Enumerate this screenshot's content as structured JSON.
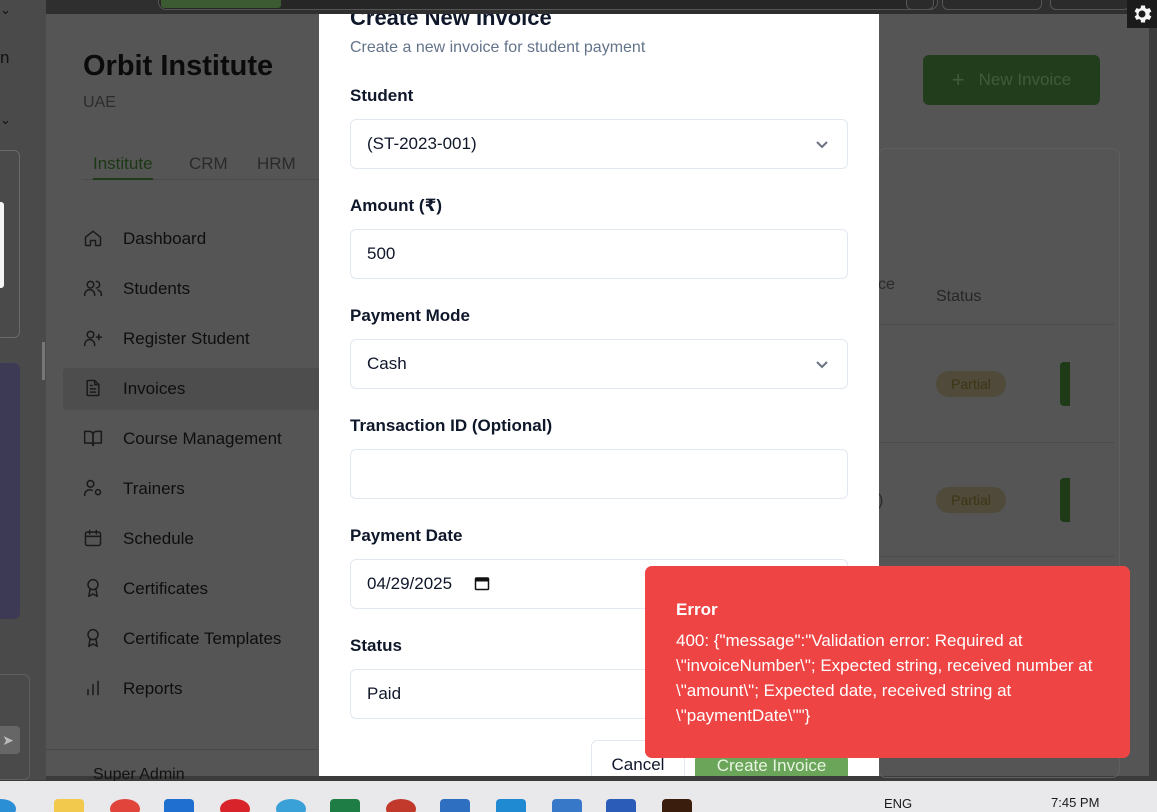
{
  "app": {
    "brand_title": "Orbit Institute",
    "brand_subtitle": "UAE",
    "tabs": [
      {
        "label": "Institute",
        "active": true
      },
      {
        "label": "CRM",
        "active": false
      },
      {
        "label": "HRM",
        "active": false
      }
    ],
    "nav": [
      {
        "label": "Dashboard",
        "icon": "home-icon"
      },
      {
        "label": "Students",
        "icon": "users-icon"
      },
      {
        "label": "Register Student",
        "icon": "user-plus-icon"
      },
      {
        "label": "Invoices",
        "icon": "file-text-icon",
        "active": true
      },
      {
        "label": "Course Management",
        "icon": "book-open-icon"
      },
      {
        "label": "Trainers",
        "icon": "user-cog-icon"
      },
      {
        "label": "Schedule",
        "icon": "calendar-icon"
      },
      {
        "label": "Certificates",
        "icon": "award-icon"
      },
      {
        "label": "Certificate Templates",
        "icon": "award-icon"
      },
      {
        "label": "Reports",
        "icon": "bar-chart-icon"
      }
    ],
    "footer_user": "Super Admin",
    "new_invoice_button": "New Invoice",
    "table": {
      "column_fragment": "ce",
      "status_header": "Status",
      "rows": [
        {
          "status": "Partial"
        },
        {
          "status": "Partial",
          "amount_fragment": ")"
        }
      ]
    }
  },
  "modal": {
    "title": "Create New Invoice",
    "subtitle": "Create a new invoice for student payment",
    "fields": {
      "student": {
        "label": "Student",
        "value": "(ST-2023-001)"
      },
      "amount": {
        "label": "Amount (₹)",
        "value": "500"
      },
      "payment_mode": {
        "label": "Payment Mode",
        "value": "Cash"
      },
      "transaction_id": {
        "label": "Transaction ID (Optional)",
        "value": ""
      },
      "payment_date": {
        "label": "Payment Date",
        "value": "04/29/2025"
      },
      "status": {
        "label": "Status",
        "value": "Paid"
      }
    },
    "cancel_button": "Cancel",
    "create_button": "Create Invoice"
  },
  "toast": {
    "title": "Error",
    "message": "400: {\"message\":\"Validation error: Required at \\\"invoiceNumber\\\"; Expected string, received number at \\\"amount\\\"; Expected date, received string at \\\"paymentDate\\\"\"}"
  },
  "left_strip": {
    "letter": "n"
  },
  "taskbar": {
    "language": "ENG",
    "time": "7:45 PM"
  },
  "colors": {
    "primary_green": "#6aa55a",
    "toast_red": "#ef4444",
    "overlay": "#545554"
  }
}
